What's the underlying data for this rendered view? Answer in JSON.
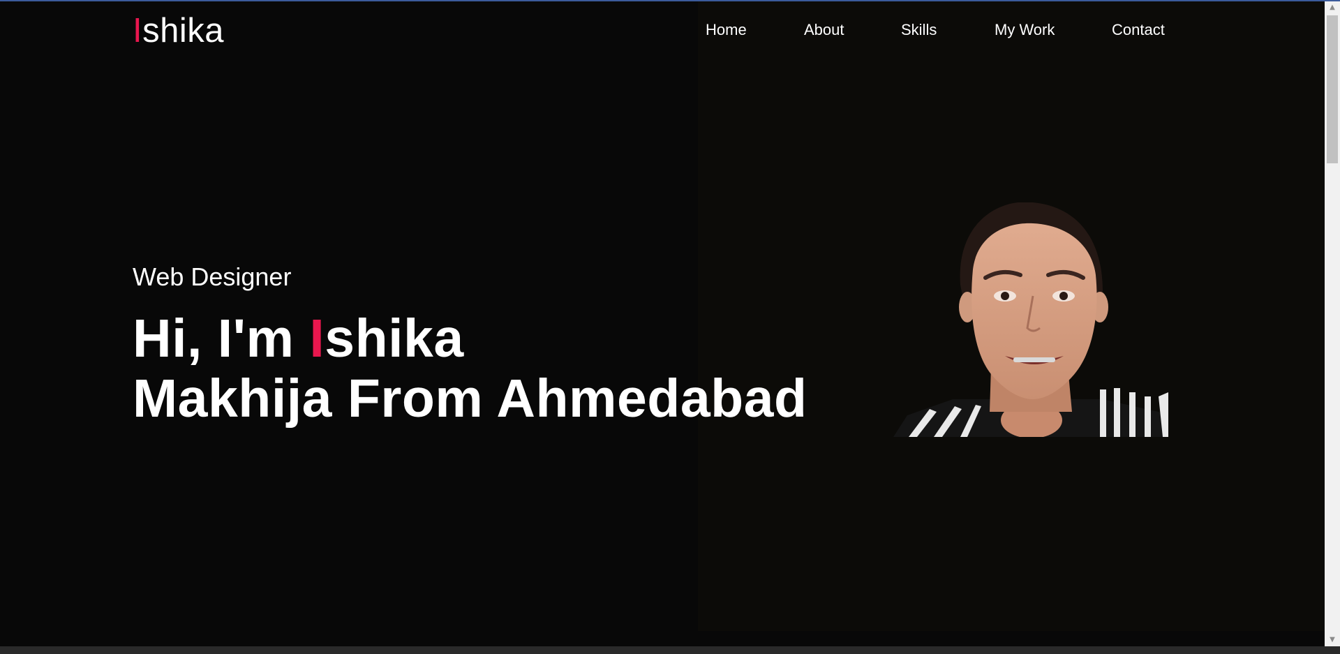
{
  "header": {
    "logo_first_letter": "I",
    "logo_rest": "shika",
    "nav": [
      {
        "label": "Home"
      },
      {
        "label": "About"
      },
      {
        "label": "Skills"
      },
      {
        "label": "My Work"
      },
      {
        "label": "Contact"
      }
    ]
  },
  "hero": {
    "role": "Web Designer",
    "greeting": "Hi, I'm ",
    "name_first_letter": "I",
    "name_rest_line1": "shika",
    "line2": "Makhija From Ahmedabad",
    "portrait_icon": "portrait-photo-icon"
  },
  "colors": {
    "accent": "#e8174e",
    "background": "#080808",
    "panel": "#0c0b08",
    "text": "#ffffff"
  }
}
